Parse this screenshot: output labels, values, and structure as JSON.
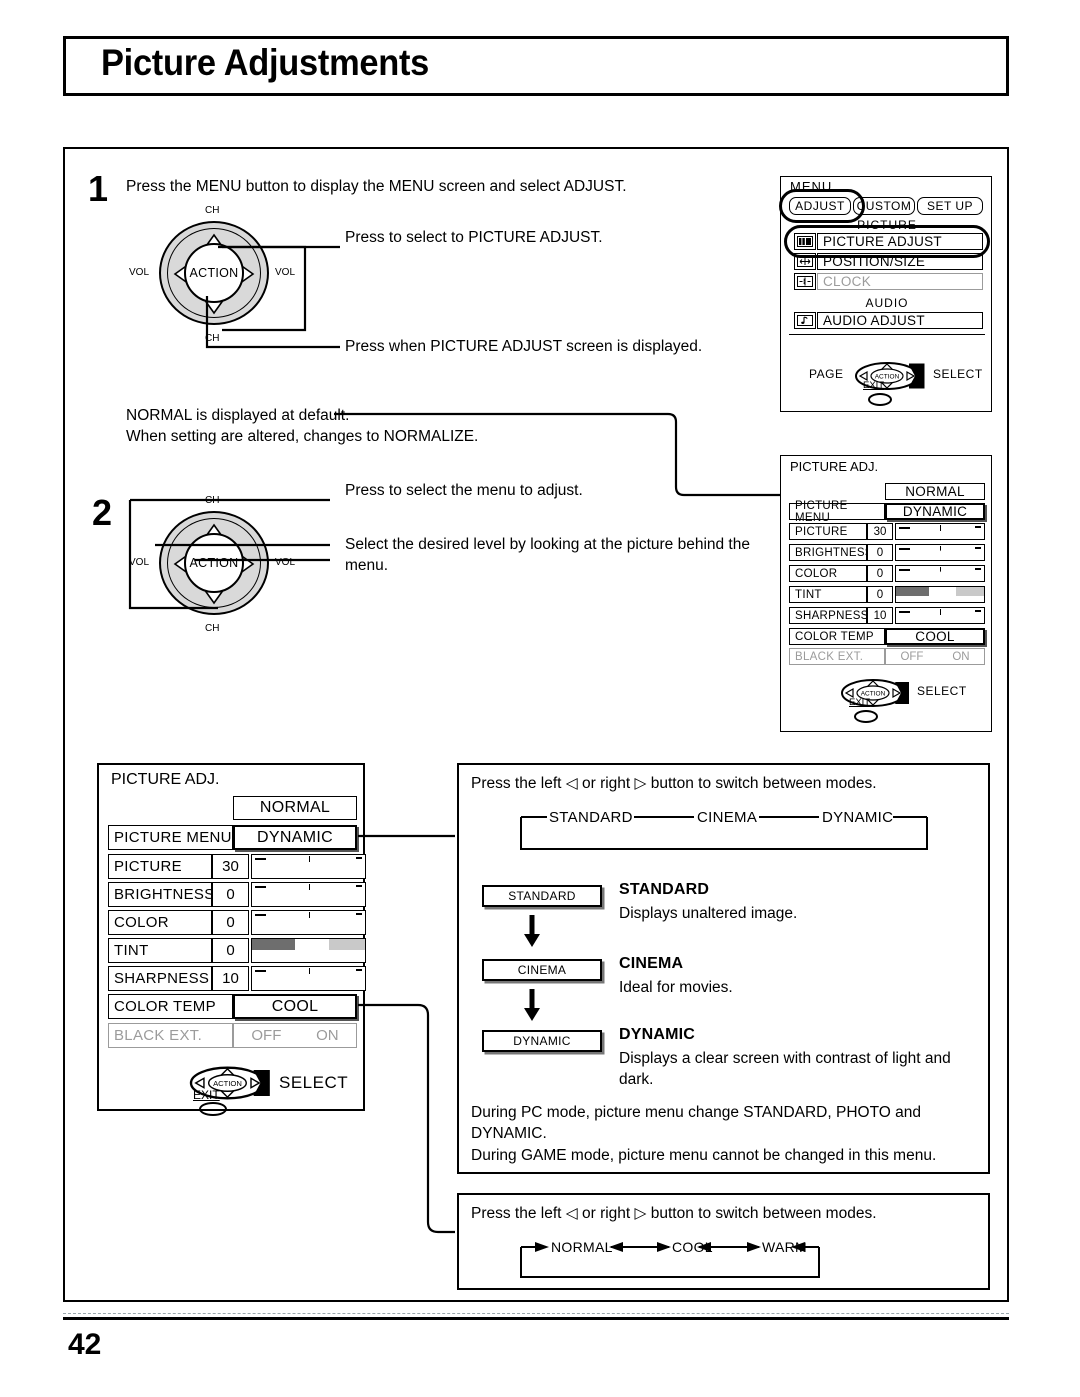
{
  "page": {
    "title": "Picture Adjustments",
    "number": "42"
  },
  "steps": [
    {
      "num": "1",
      "instruction": "Press the MENU button to display the MENU screen and select  ADJUST.",
      "callouts": [
        "Press to select to PICTURE ADJUST.",
        "Press when PICTURE ADJUST screen is displayed."
      ]
    },
    {
      "num": "2",
      "callouts": [
        "Press to select the menu to adjust.",
        "Select the desired level by looking at the picture behind the menu."
      ]
    }
  ],
  "normalize_note": "NORMAL is displayed at default.\nWhen setting are altered, changes to NORMALIZE.",
  "remote": {
    "action_label": "ACTION",
    "ch_label": "CH",
    "vol_label": "VOL"
  },
  "menu_screen": {
    "heading": "MENU",
    "tabs": [
      "ADJUST",
      "CUSTOM",
      "SET UP"
    ],
    "selected_tab": "ADJUST",
    "group_picture": "PICTURE",
    "group_audio": "AUDIO",
    "picture_items": [
      {
        "label": "PICTURE  ADJUST",
        "icon": "contrast-bars-icon",
        "dimmed": false,
        "highlighted": true
      },
      {
        "label": "POSITION/SIZE",
        "icon": "move-arrows-icon",
        "dimmed": false,
        "highlighted": false
      },
      {
        "label": "CLOCK",
        "icon": "clock-icon",
        "dimmed": true,
        "highlighted": false
      }
    ],
    "audio_items": [
      {
        "label": "AUDIO  ADJUST",
        "icon": "music-note-icon",
        "dimmed": false,
        "highlighted": false
      }
    ],
    "footer_left": "PAGE",
    "footer_right": "SELECT",
    "exit_label": "EXIT",
    "action_label": "ACTION"
  },
  "picture_adj": {
    "title": "PICTURE ADJ.",
    "normalize_button": "NORMAL",
    "picture_menu_label": "PICTURE  MENU",
    "picture_menu_value": "DYNAMIC",
    "sliders": [
      {
        "label": "PICTURE",
        "value": "30",
        "pos": 84,
        "tinted": false
      },
      {
        "label": "BRIGHTNESS",
        "value": "0",
        "pos": 50,
        "tinted": false
      },
      {
        "label": "COLOR",
        "value": "0",
        "pos": 50,
        "tinted": false
      },
      {
        "label": "TINT",
        "value": "0",
        "pos": 50,
        "tinted": true
      },
      {
        "label": "SHARPNESS",
        "value": "10",
        "pos": 64,
        "tinted": false
      }
    ],
    "color_temp_label": "COLOR  TEMP",
    "color_temp_value": "COOL",
    "black_ext_label": "BLACK EXT.",
    "black_ext_off": "OFF",
    "black_ext_on": "ON",
    "select_label": "SELECT",
    "exit_label": "EXIT",
    "action_label": "ACTION"
  },
  "picture_menu_panel": {
    "intro": "Press the left ◁ or right ▷ button to switch between modes.",
    "cycle": [
      "STANDARD",
      "CINEMA",
      "DYNAMIC"
    ],
    "modes": [
      {
        "chip": "STANDARD",
        "name": "STANDARD",
        "desc": "Displays unaltered image."
      },
      {
        "chip": "CINEMA",
        "name": "CINEMA",
        "desc": "Ideal for movies."
      },
      {
        "chip": "DYNAMIC",
        "name": "DYNAMIC",
        "desc": "Displays a clear screen with contrast of light and dark."
      }
    ],
    "notes": [
      "During PC mode, picture menu change STANDARD, PHOTO and DYNAMIC.",
      "During GAME mode, picture menu cannot be changed in this menu."
    ]
  },
  "color_temp_panel": {
    "intro": "Press the left ◁ or right ▷ button to switch between modes.",
    "cycle": [
      "NORMAL",
      "COOL",
      "WARM"
    ]
  },
  "colors": {
    "ink": "#000000",
    "dimmed": "#9b9b9b",
    "pad_fill": "#d9d9d9",
    "shadow": "#777777",
    "tint_dark": "#6e6e6e",
    "tint_light": "#c9c9c9"
  }
}
